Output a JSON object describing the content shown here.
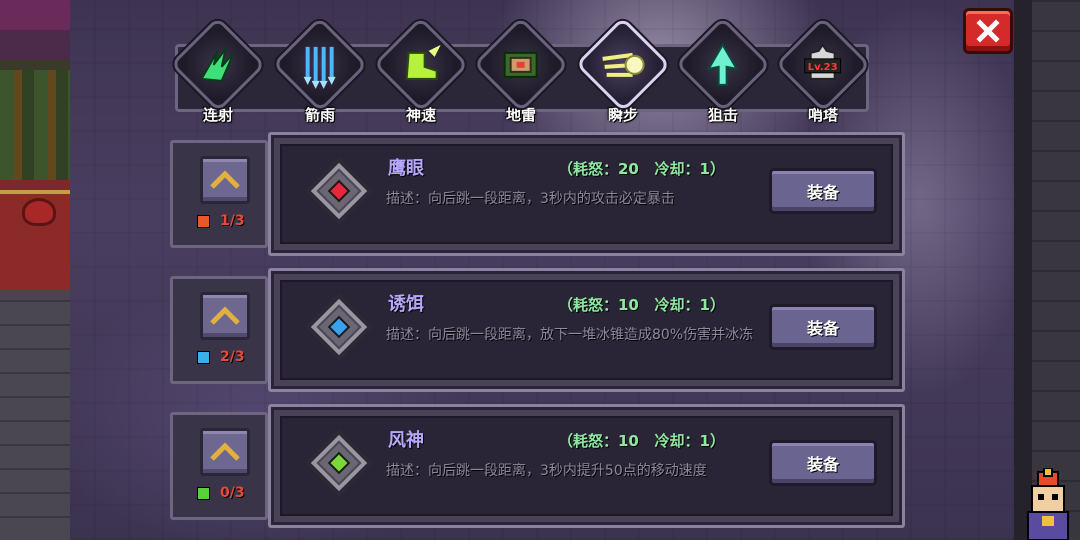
{
  "tabs": [
    {
      "label": "连射",
      "icon": "rapid-fire-icon",
      "color": "#3fe07a",
      "active": false
    },
    {
      "label": "箭雨",
      "icon": "arrow-rain-icon",
      "color": "#4ab8ff",
      "active": false
    },
    {
      "label": "神速",
      "icon": "swift-boot-icon",
      "color": "#b8f040",
      "active": false
    },
    {
      "label": "地雷",
      "icon": "landmine-icon",
      "color": "#5fc05a",
      "active": false
    },
    {
      "label": "瞬步",
      "icon": "flash-step-icon",
      "color": "#f0f080",
      "active": true
    },
    {
      "label": "狙击",
      "icon": "snipe-arrow-icon",
      "color": "#6ff0d0",
      "active": false
    },
    {
      "label": "哨塔",
      "icon": "sentry-tower-icon",
      "color": "#e8e8e8",
      "active": false,
      "badge": "Lv.23"
    }
  ],
  "skills": [
    {
      "name": "鹰眼",
      "cost": "（耗怒：20   冷却：1）",
      "description": "描述：向后跳一段距离，3秒内的攻击必定暴击",
      "level": "1/3",
      "gem_color": "#e8283a",
      "level_color": "#e8582a",
      "equip_label": "装备"
    },
    {
      "name": "诱饵",
      "cost": "（耗怒：10   冷却：1）",
      "description": "描述：向后跳一段距离，放下一堆冰锥造成80%伤害并冰冻",
      "level": "2/3",
      "gem_color": "#3aa0f0",
      "level_color": "#3ab0e8",
      "equip_label": "装备"
    },
    {
      "name": "风神",
      "cost": "（耗怒：10   冷却：1）",
      "description": "描述：向后跳一段距离，3秒内提升50点的移动速度",
      "level": "0/3",
      "gem_color": "#7ad83a",
      "level_color": "#5ad03a",
      "equip_label": "装备"
    }
  ]
}
